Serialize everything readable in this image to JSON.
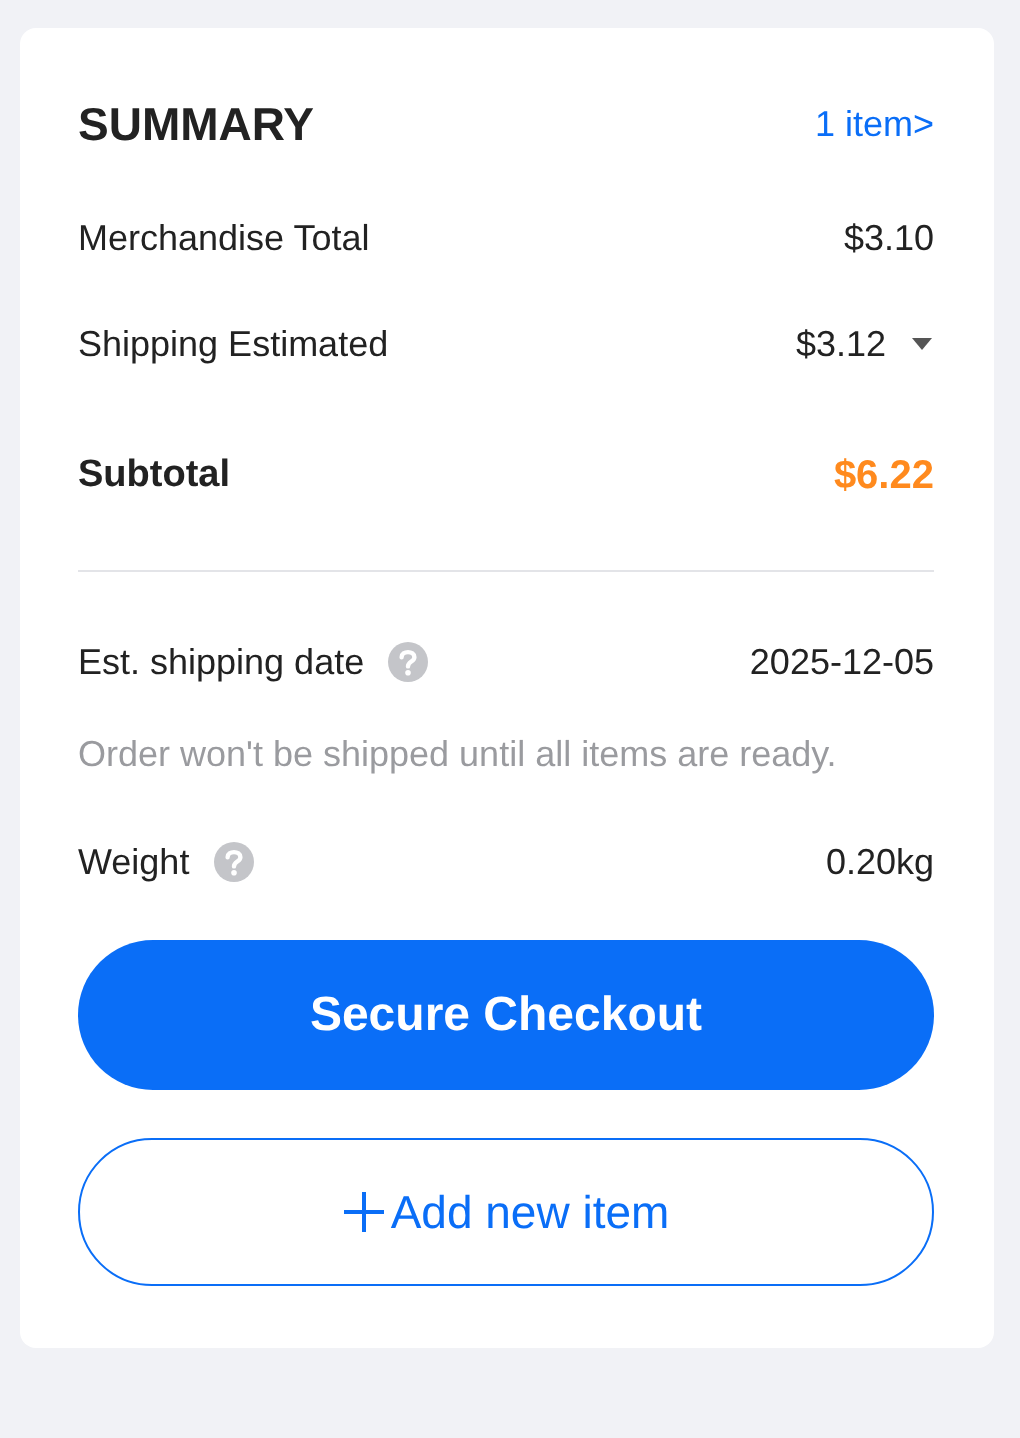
{
  "summary": {
    "title": "SUMMARY",
    "items_link": "1 item>"
  },
  "rows": [
    {
      "label": "Merchandise Total",
      "value": "$3.10",
      "kind": "plain"
    },
    {
      "label": "Shipping Estimated",
      "value": "$3.12",
      "kind": "dropdown"
    }
  ],
  "subtotal": {
    "label": "Subtotal",
    "value": "$6.22"
  },
  "details": [
    {
      "label": "Est. shipping date",
      "value": "2025-12-05",
      "help": true,
      "note": "Order won't be shipped until all items are ready."
    },
    {
      "label": "Weight",
      "value": "0.20kg",
      "help": true
    }
  ],
  "buttons": [
    {
      "label": "Secure Checkout",
      "kind": "primary"
    },
    {
      "label": "Add new item",
      "kind": "outline"
    }
  ]
}
